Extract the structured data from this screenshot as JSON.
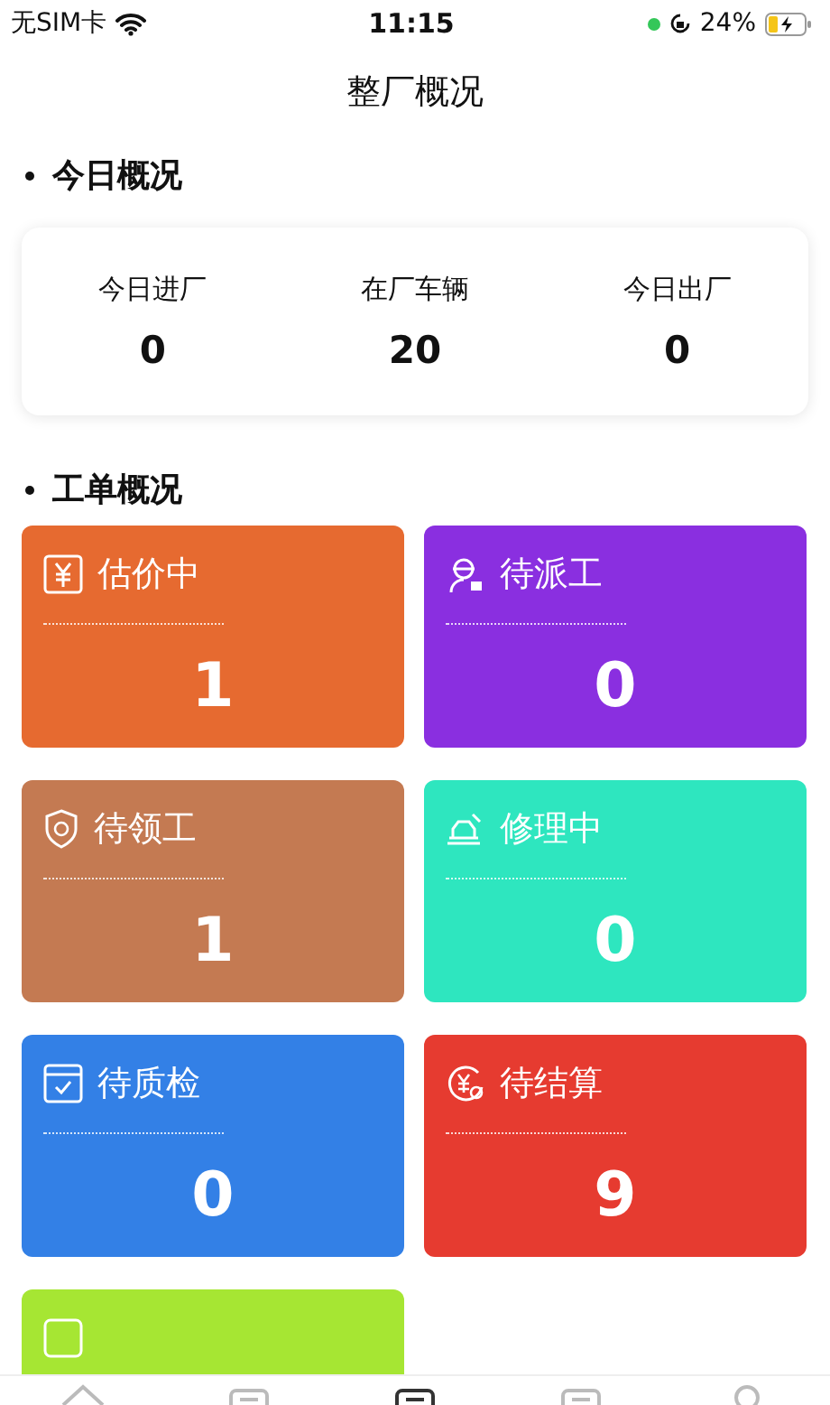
{
  "status_bar": {
    "carrier": "无SIM卡",
    "time": "11:15",
    "battery": "24%",
    "charging": true
  },
  "title": "整厂概况",
  "today": {
    "heading": "今日概况",
    "stats": [
      {
        "label": "今日进厂",
        "value": "0"
      },
      {
        "label": "在厂车辆",
        "value": "20"
      },
      {
        "label": "今日出厂",
        "value": "0"
      }
    ]
  },
  "orders": {
    "heading": "工单概况",
    "cards": [
      {
        "kind": "quote",
        "title": "估价中",
        "count": "1",
        "color": "#e66a30"
      },
      {
        "kind": "dispatch",
        "title": "待派工",
        "count": "0",
        "color": "#8a2fe0"
      },
      {
        "kind": "claim",
        "title": "待领工",
        "count": "1",
        "color": "#c47a52"
      },
      {
        "kind": "repair",
        "title": "修理中",
        "count": "0",
        "color": "#2ee6bf"
      },
      {
        "kind": "inspect",
        "title": "待质检",
        "count": "0",
        "color": "#3380e6"
      },
      {
        "kind": "settle",
        "title": "待结算",
        "count": "9",
        "color": "#e63b30"
      },
      {
        "kind": "exit",
        "color": "#a6e633"
      }
    ]
  },
  "tab_bar": [
    {
      "selected": false
    },
    {
      "selected": false
    },
    {
      "selected": true
    },
    {
      "selected": false
    },
    {
      "selected": false
    }
  ]
}
